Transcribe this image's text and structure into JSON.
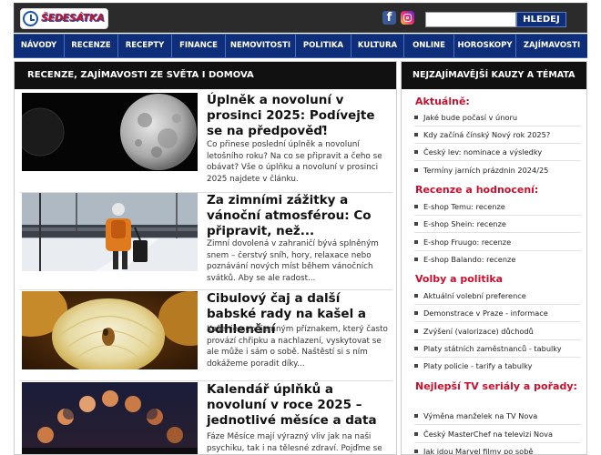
{
  "header": {
    "logo_text": "ŠEDESÁTKA",
    "search_placeholder": "",
    "search_button": "HLEDEJ"
  },
  "nav": [
    "NÁVODY",
    "RECENZE",
    "RECEPTY",
    "FINANCE",
    "NEMOVITOSTI",
    "POLITIKA",
    "KULTURA",
    "ONLINE",
    "HOROSKOPY",
    "ZAJÍMAVOSTI"
  ],
  "left": {
    "heading": "RECENZE, ZAJÍMAVOSTI ZE SVĚTA I DOMOVA",
    "articles": [
      {
        "title": "Úplněk a novoluní v prosinci 2025: Podívejte se na předpověď!",
        "excerpt": "Co přinese poslední úplněk a novoluní letošního roku? Na co se připravit a čeho se obávat? Vše o úplňku a novoluní v prosinci 2025 najdete v článku."
      },
      {
        "title": "Za zimními zážitky a vánoční atmosférou: Co připravit, než...",
        "excerpt": "Zimní dovolená v zahraničí bývá splněným snem – čerstvý sníh, hory, relaxace nebo poznávání nových míst během vánočních svátků. Aby se ale radost..."
      },
      {
        "title": "Cibulový čaj a další babské rady na kašel a odhlenění",
        "excerpt": "Kašel je nepříjemným příznakem, který často provází chřipku a nachlazení, vyskytovat se ale může i sám o sobě. Naštěstí si s ním dokážeme poradit díky..."
      },
      {
        "title": "Kalendář úplňků a novoluní v roce 2025 – jednotlivé měsíce a data",
        "excerpt": "Fáze Měsíce mají výrazný vliv jak na naši psychiku, tak i na tělesné zdraví. Pojďme se podívat na to, kdy nás čekají úplňky..."
      }
    ]
  },
  "right": {
    "heading": "NEJZAJÍMAVĚJŠÍ KAUZY A TÉMATA",
    "sections": [
      {
        "title": "Aktuálně:",
        "links": [
          "Jaké bude počasí v únoru",
          "Kdy začíná čínský Nový rok 2025?",
          "Český lev: nominace a výsledky",
          "Termíny jarních prázdnin 2024/25"
        ]
      },
      {
        "title": "Recenze a hodnocení:",
        "links": [
          "E-shop Temu: recenze",
          "E-shop Shein: recenze",
          "E-shop Fruugo: recenze",
          "E-shop Balando: recenze"
        ]
      },
      {
        "title": "Volby a politika",
        "links": [
          "Aktuální volební preference",
          "Demonstrace v Praze - informace",
          "Zvýšení (valorizace) důchodů",
          "Platy státních zaměstnanců - tabulky",
          "Platy policie - tarify a tabulky"
        ]
      },
      {
        "title": "Nejlepší TV seriály a pořady:",
        "links": [
          "Výměna manželek na TV Nova",
          "Český MasterChef na televizi Nova",
          "Jak jdou Marvel filmy po sobě"
        ]
      }
    ]
  },
  "colors": {
    "accent_red": "#c8102e",
    "nav_blue": "#0f2e7a",
    "header_dark": "#2b2b2b"
  }
}
